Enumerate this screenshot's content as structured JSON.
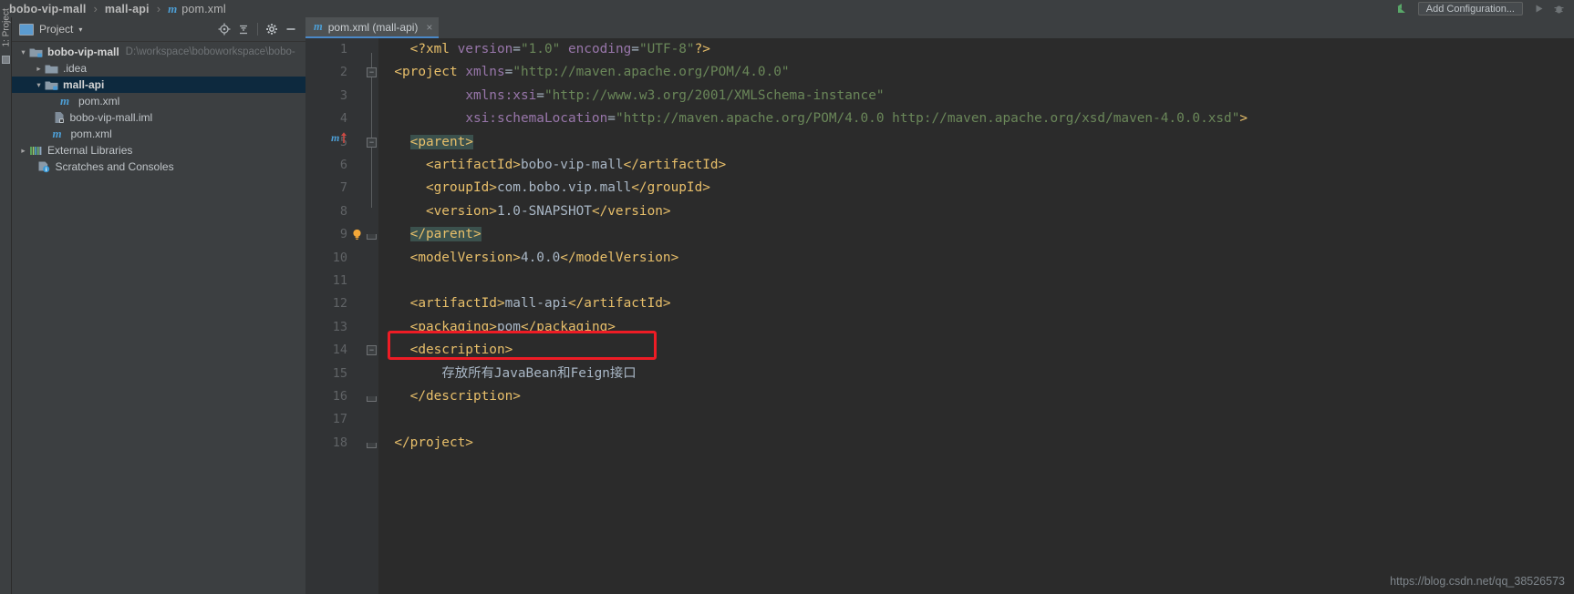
{
  "window": {
    "breadcrumb": [
      {
        "label": "bobo-vip-mall",
        "icon": "none",
        "bold": true
      },
      {
        "label": "mall-api",
        "icon": "none",
        "bold": true
      },
      {
        "label": "pom.xml",
        "icon": "maven-icon",
        "bold": false
      }
    ],
    "separator": "›",
    "run_config_label": "Add Configuration...",
    "toolbar_icons": [
      "update-project-icon",
      "run-icon",
      "debug-icon"
    ],
    "watermark": "https://blog.csdn.net/qq_38526573"
  },
  "sidebar": {
    "vertical_label": "1: Project",
    "title": "Project",
    "caret": "▾",
    "actions": [
      "locate-icon",
      "collapse-all-icon",
      "settings-gear-icon",
      "hide-icon"
    ],
    "tree": [
      {
        "arrow": "⌄",
        "icon": "module-folder-icon",
        "label": "bobo-vip-mall",
        "bold": true,
        "path": "D:\\workspace\\boboworkspace\\bobo-",
        "indent": 0,
        "selected": false
      },
      {
        "arrow": "›",
        "icon": "folder-icon",
        "label": ".idea",
        "bold": false,
        "path": "",
        "indent": 1,
        "selected": false
      },
      {
        "arrow": "⌄",
        "icon": "module-folder-icon",
        "label": "mall-api",
        "bold": true,
        "path": "",
        "indent": 1,
        "selected": true
      },
      {
        "arrow": "",
        "icon": "maven-icon",
        "label": "pom.xml",
        "bold": false,
        "path": "",
        "indent": 2,
        "selected": false
      },
      {
        "arrow": "",
        "icon": "iml-file-icon",
        "label": "bobo-vip-mall.iml",
        "bold": false,
        "path": "",
        "indent": 1.5,
        "selected": false
      },
      {
        "arrow": "",
        "icon": "maven-icon",
        "label": "pom.xml",
        "bold": false,
        "path": "",
        "indent": 1.5,
        "selected": false
      },
      {
        "arrow": "›",
        "icon": "library-icon",
        "label": "External Libraries",
        "bold": false,
        "path": "",
        "indent": 0,
        "selected": false
      },
      {
        "arrow": "",
        "icon": "scratches-icon",
        "label": "Scratches and Consoles",
        "bold": false,
        "path": "",
        "indent": 0.5,
        "selected": false
      }
    ]
  },
  "editor": {
    "tab": {
      "label": "pom.xml (mall-api)",
      "icon": "maven-icon",
      "close": "×"
    },
    "lines": [
      {
        "n": "1",
        "tokens": [
          {
            "t": "txt",
            "s": "    "
          },
          {
            "t": "tag",
            "s": "<?xml "
          },
          {
            "t": "attr",
            "s": "version"
          },
          {
            "t": "eq",
            "s": "="
          },
          {
            "t": "str",
            "s": "\"1.0\""
          },
          {
            "t": "txt",
            "s": " "
          },
          {
            "t": "attr",
            "s": "encoding"
          },
          {
            "t": "eq",
            "s": "="
          },
          {
            "t": "str",
            "s": "\"UTF-8\""
          },
          {
            "t": "tag",
            "s": "?>"
          }
        ]
      },
      {
        "n": "2",
        "tokens": [
          {
            "t": "txt",
            "s": "  "
          },
          {
            "t": "tag",
            "s": "<project "
          },
          {
            "t": "attr",
            "s": "xmlns"
          },
          {
            "t": "eq",
            "s": "="
          },
          {
            "t": "str",
            "s": "\"http://maven.apache.org/POM/4.0.0\""
          }
        ]
      },
      {
        "n": "3",
        "tokens": [
          {
            "t": "txt",
            "s": "           "
          },
          {
            "t": "attr",
            "s": "xmlns:"
          },
          {
            "t": "attr2",
            "s": "xsi"
          },
          {
            "t": "eq",
            "s": "="
          },
          {
            "t": "str",
            "s": "\"http://www.w3.org/2001/XMLSchema-instance\""
          }
        ]
      },
      {
        "n": "4",
        "tokens": [
          {
            "t": "txt",
            "s": "           "
          },
          {
            "t": "attr",
            "s": "xsi:"
          },
          {
            "t": "attr2",
            "s": "schemaLocation"
          },
          {
            "t": "eq",
            "s": "="
          },
          {
            "t": "str",
            "s": "\"http://maven.apache.org/POM/4.0.0 http://maven.apache.org/xsd/maven-4.0.0.xsd\""
          },
          {
            "t": "tag",
            "s": ">"
          }
        ]
      },
      {
        "n": "5",
        "tokens": [
          {
            "t": "txt",
            "s": "    "
          },
          {
            "t": "hl",
            "s": "<parent>"
          }
        ]
      },
      {
        "n": "6",
        "tokens": [
          {
            "t": "txt",
            "s": "      "
          },
          {
            "t": "tag",
            "s": "<artifactId>"
          },
          {
            "t": "txt",
            "s": "bobo-vip-mall"
          },
          {
            "t": "tag",
            "s": "</artifactId>"
          }
        ]
      },
      {
        "n": "7",
        "tokens": [
          {
            "t": "txt",
            "s": "      "
          },
          {
            "t": "tag",
            "s": "<groupId>"
          },
          {
            "t": "txt",
            "s": "com.bobo.vip.mall"
          },
          {
            "t": "tag",
            "s": "</groupId>"
          }
        ]
      },
      {
        "n": "8",
        "tokens": [
          {
            "t": "txt",
            "s": "      "
          },
          {
            "t": "tag",
            "s": "<version>"
          },
          {
            "t": "txt",
            "s": "1.0-SNAPSHOT"
          },
          {
            "t": "tag",
            "s": "</version>"
          }
        ]
      },
      {
        "n": "9",
        "tokens": [
          {
            "t": "txt",
            "s": "    "
          },
          {
            "t": "hl",
            "s": "</parent>"
          }
        ]
      },
      {
        "n": "10",
        "tokens": [
          {
            "t": "txt",
            "s": "    "
          },
          {
            "t": "tag",
            "s": "<modelVersion>"
          },
          {
            "t": "txt",
            "s": "4.0.0"
          },
          {
            "t": "tag",
            "s": "</modelVersion>"
          }
        ]
      },
      {
        "n": "11",
        "tokens": []
      },
      {
        "n": "12",
        "tokens": [
          {
            "t": "txt",
            "s": "    "
          },
          {
            "t": "tag",
            "s": "<artifactId>"
          },
          {
            "t": "txt",
            "s": "mall-api"
          },
          {
            "t": "tag",
            "s": "</artifactId>"
          }
        ]
      },
      {
        "n": "13",
        "tokens": [
          {
            "t": "txt",
            "s": "    "
          },
          {
            "t": "tag",
            "s": "<packaging>"
          },
          {
            "t": "txt",
            "s": "pom"
          },
          {
            "t": "tag",
            "s": "</packaging>"
          }
        ]
      },
      {
        "n": "14",
        "tokens": [
          {
            "t": "txt",
            "s": "    "
          },
          {
            "t": "tag",
            "s": "<description>"
          }
        ]
      },
      {
        "n": "15",
        "tokens": [
          {
            "t": "txt",
            "s": "        "
          },
          {
            "t": "txt",
            "s": "存放所有JavaBean和Feign接口"
          }
        ]
      },
      {
        "n": "16",
        "tokens": [
          {
            "t": "txt",
            "s": "    "
          },
          {
            "t": "tag",
            "s": "</description>"
          }
        ]
      },
      {
        "n": "17",
        "tokens": []
      },
      {
        "n": "18",
        "tokens": [
          {
            "t": "txt",
            "s": "  "
          },
          {
            "t": "tag",
            "s": "</project>"
          }
        ]
      }
    ],
    "gutter_markers": [
      {
        "line": 2,
        "type": "fold-collapse-icon"
      },
      {
        "line": 5,
        "type": "fold-collapse-icon"
      },
      {
        "line": 5,
        "type": "maven-inherited-icon"
      },
      {
        "line": 9,
        "type": "intention-bulb-icon"
      },
      {
        "line": 9,
        "type": "fold-end-icon"
      },
      {
        "line": 14,
        "type": "fold-collapse-icon"
      },
      {
        "line": 16,
        "type": "fold-end-icon"
      },
      {
        "line": 18,
        "type": "fold-end-icon"
      }
    ],
    "annotation": {
      "type": "red-highlight-box",
      "line": 13,
      "color": "#ee1c25"
    }
  },
  "colors": {
    "tag": "#e8bf6a",
    "attribute": "#9876aa",
    "string": "#6a8759",
    "text": "#a9b7c6",
    "accent": "#4a88c7",
    "selection": "#0d293e",
    "editor_bg": "#2b2b2b",
    "panel_bg": "#3c3f41"
  }
}
